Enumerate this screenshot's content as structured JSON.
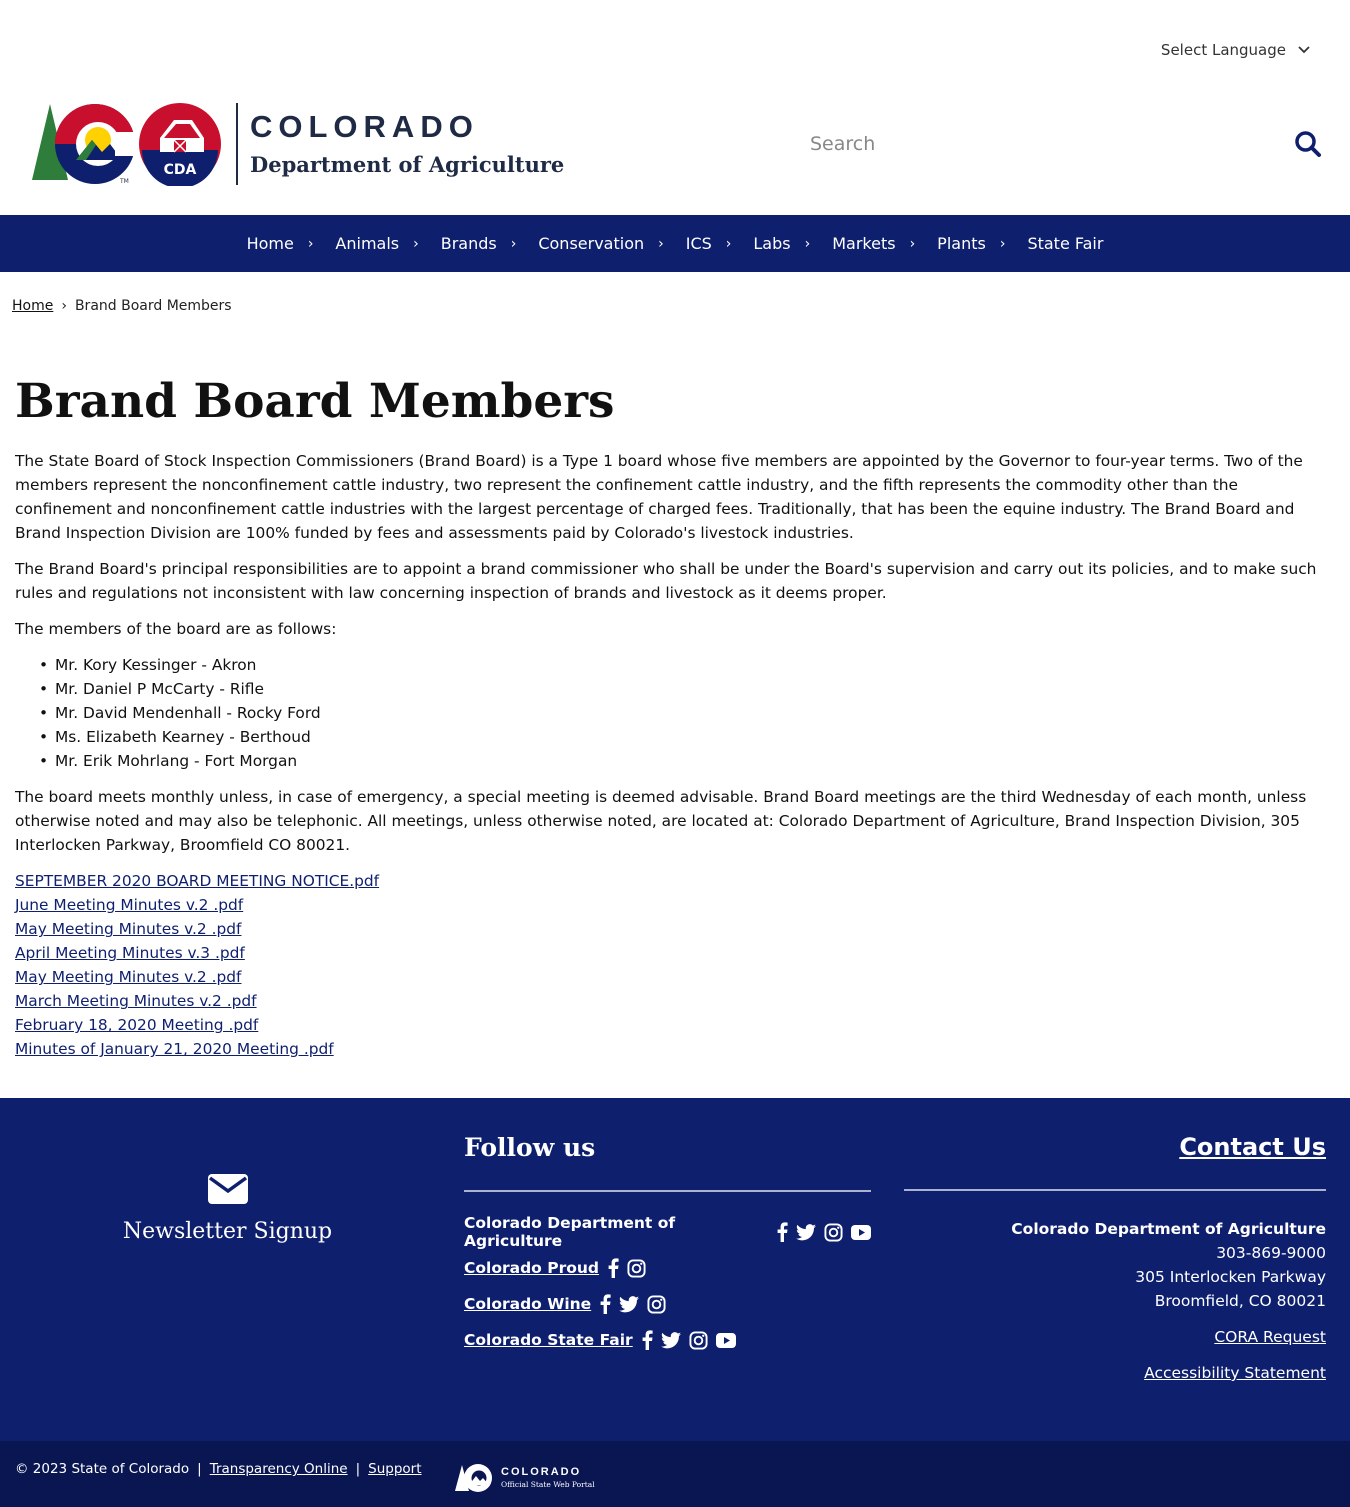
{
  "header": {
    "language_label": "Select Language",
    "logo_co": "COLORADO",
    "logo_dept": "Department of Agriculture",
    "logo_badge": "CDA",
    "search_placeholder": "Search"
  },
  "nav": {
    "items": [
      "Home",
      "Animals",
      "Brands",
      "Conservation",
      "ICS",
      "Labs",
      "Markets",
      "Plants",
      "State Fair"
    ]
  },
  "breadcrumb": {
    "home": "Home",
    "separator": "›",
    "current": "Brand Board Members"
  },
  "main": {
    "title": "Brand Board Members",
    "para1": "The State Board of Stock Inspection Commissioners (Brand Board) is a Type 1 board whose five members are appointed by the Governor to four-year terms. Two of the members represent the nonconfinement cattle industry, two represent the confinement cattle industry, and the fifth represents the commodity other than the confinement and nonconfinement cattle industries with the largest percentage of charged fees. Traditionally, that has been the equine industry. The Brand Board and Brand Inspection Division are 100% funded by fees and assessments paid by Colorado's livestock industries.",
    "para2": "The Brand Board's principal responsibilities are to appoint a brand commissioner who shall be under the Board's supervision and carry out its policies, and to make such rules and regulations not inconsistent with law concerning inspection of brands and livestock as it deems proper.",
    "para3": "The members of the board are as follows:",
    "members": [
      "Mr. Kory Kessinger - Akron",
      "Mr. Daniel P McCarty - Rifle",
      "Mr. David Mendenhall - Rocky Ford",
      "Ms. Elizabeth Kearney - Berthoud",
      "Mr. Erik Mohrlang - Fort Morgan"
    ],
    "para4": "The board meets monthly unless, in case of emergency, a special meeting is deemed advisable. Brand Board meetings are the third Wednesday of each month, unless otherwise noted and may also be telephonic. All meetings, unless otherwise noted, are located at: Colorado Department of Agriculture, Brand Inspection Division, 305 Interlocken Parkway, Broomfield CO 80021.",
    "documents": [
      "SEPTEMBER 2020 BOARD MEETING NOTICE.pdf",
      "June Meeting Minutes v.2 .pdf",
      "May Meeting Minutes v.2 .pdf",
      "April Meeting Minutes v.3 .pdf",
      "May Meeting Minutes v.2 .pdf",
      "March Meeting Minutes v.2 .pdf",
      "February 18, 2020 Meeting .pdf",
      "Minutes of January 21, 2020 Meeting .pdf"
    ]
  },
  "footer": {
    "newsletter": "Newsletter Signup",
    "follow_title": "Follow us",
    "follow": [
      {
        "name": "Colorado Department of Agriculture",
        "icons": [
          "facebook-icon",
          "twitter-icon",
          "instagram-icon",
          "youtube-icon"
        ]
      },
      {
        "name": "Colorado Proud",
        "icons": [
          "facebook-icon",
          "instagram-icon"
        ]
      },
      {
        "name": "Colorado Wine",
        "icons": [
          "facebook-icon",
          "twitter-icon",
          "instagram-icon"
        ]
      },
      {
        "name": "Colorado State Fair",
        "icons": [
          "facebook-icon",
          "twitter-icon",
          "instagram-icon",
          "youtube-icon"
        ]
      }
    ],
    "contact_title": "Contact Us",
    "org": "Colorado Department of Agriculture",
    "phone": "303-869-9000",
    "address1": "305 Interlocken Parkway",
    "address2": "Broomfield, CO 80021",
    "cora": "CORA Request",
    "accessibility": "Accessibility Statement"
  },
  "bottom": {
    "copyright": "© 2023 State of Colorado",
    "sep": "|",
    "transparency": "Transparency Online",
    "support": "Support",
    "portal_title": "COLORADO",
    "portal_sub": "Official State Web Portal"
  },
  "colors": {
    "navy": "#0e1f6e",
    "footer_bottom": "#0a1652",
    "red": "#c8102e",
    "gold": "#ffd100",
    "green": "#2e7d3a"
  }
}
